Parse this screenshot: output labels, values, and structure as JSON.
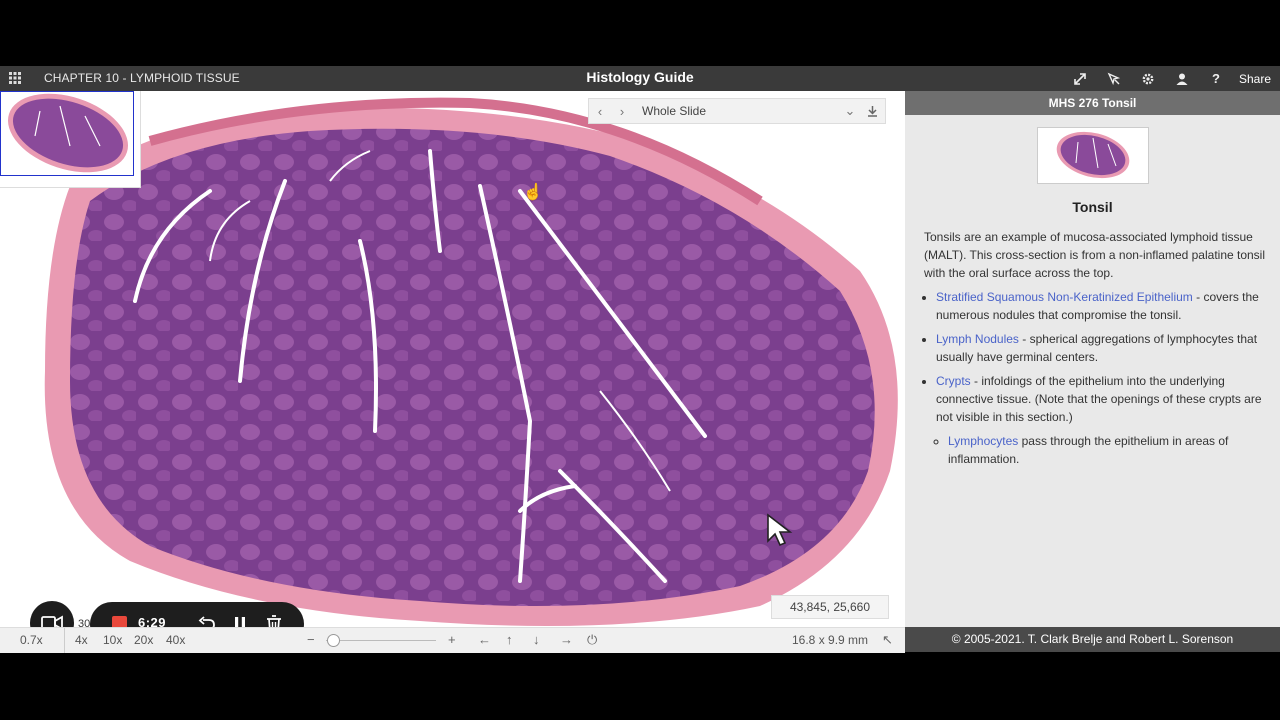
{
  "header": {
    "chapter": "CHAPTER 10 - LYMPHOID TISSUE",
    "title": "Histology Guide",
    "share_label": "Share",
    "tool_icons": [
      "fullscreen-icon",
      "pointer-icon",
      "settings-icon",
      "user-icon",
      "help-icon"
    ]
  },
  "viewer": {
    "slide_selector": "Whole Slide",
    "coordinates": "43,845,  25,660",
    "scale_label_partial": "30",
    "zoom_levels": [
      "0.7x",
      "4x",
      "10x",
      "20x",
      "40x"
    ],
    "zoom_minus": "−",
    "zoom_plus": "+",
    "zoom_level": 0.0,
    "dimensions": "16.8 x 9.9 mm"
  },
  "recorder": {
    "time": "6:29",
    "stop_color": "#e9483b"
  },
  "panel": {
    "slide_title": "MHS 276 Tonsil",
    "name": "Tonsil",
    "intro": "Tonsils are an example of mucosa-associated lymphoid tissue (MALT). This cross-section is from a non-inflamed palatine tonsil with the oral surface across the top.",
    "items": [
      {
        "link": "Stratified Squamous Non-Keratinized Epithelium",
        "text": " - covers the numerous nodules that compromise the tonsil."
      },
      {
        "link": "Lymph Nodules",
        "text": " - spherical aggregations of lymphocytes that usually have germinal centers."
      },
      {
        "link": "Crypts",
        "text": " - infoldings of the epithelium into the underlying connective tissue. (Note that the openings of these crypts are not visible in this section.)"
      }
    ],
    "subitem": {
      "link": "Lymphocytes",
      "text": " pass through the epithelium in areas of inflammation."
    }
  },
  "footer": {
    "copyright": "© 2005-2021. T. Clark Brelje and Robert L. Sorenson"
  },
  "colors": {
    "header_bg": "#3a3a3a",
    "panel_bg": "#e9e9e9",
    "link": "#4a63c9",
    "tissue_dark": "#7a3f8f",
    "tissue_light": "#e58aa6"
  }
}
